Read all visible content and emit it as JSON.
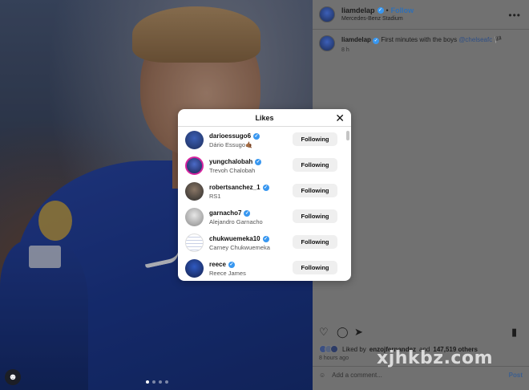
{
  "post": {
    "author": "liamdelap",
    "follow_label": "Follow",
    "dot": "•",
    "location": "Mercedes-Benz Stadium",
    "more_icon": "more-horizontal-icon",
    "caption_user": "liamdelap",
    "caption_text": "First minutes with the boys",
    "caption_mention": "@chelseafc",
    "caption_time": "8 h",
    "likes_prefix": "Liked by",
    "likes_user": "enzojfernandez",
    "likes_mid": "and",
    "likes_count": "147,519 others",
    "posted_ago": "8 hours ago",
    "comment_placeholder": "Add a comment...",
    "post_label": "Post"
  },
  "likes_modal": {
    "title": "Likes",
    "close_icon": "close-icon",
    "items": [
      {
        "username": "darioessugo6",
        "fullname": "Dário Essugo🤙🏾",
        "button": "Following"
      },
      {
        "username": "yungchalobah",
        "fullname": "Trevoh Chalobah",
        "button": "Following"
      },
      {
        "username": "robertsanchez_1",
        "fullname": "RS1",
        "button": "Following"
      },
      {
        "username": "garnacho7",
        "fullname": "Alejandro Garnacho",
        "button": "Following"
      },
      {
        "username": "chukwuemeka10",
        "fullname": "Carney Chukwuemeka",
        "button": "Following"
      },
      {
        "username": "reece",
        "fullname": "Reece James",
        "button": "Following"
      }
    ]
  },
  "watermark": "xjhkbz.com",
  "colors": {
    "verified": "#3897f0",
    "follow": "#2f6fb5",
    "button_bg": "#efefef"
  }
}
